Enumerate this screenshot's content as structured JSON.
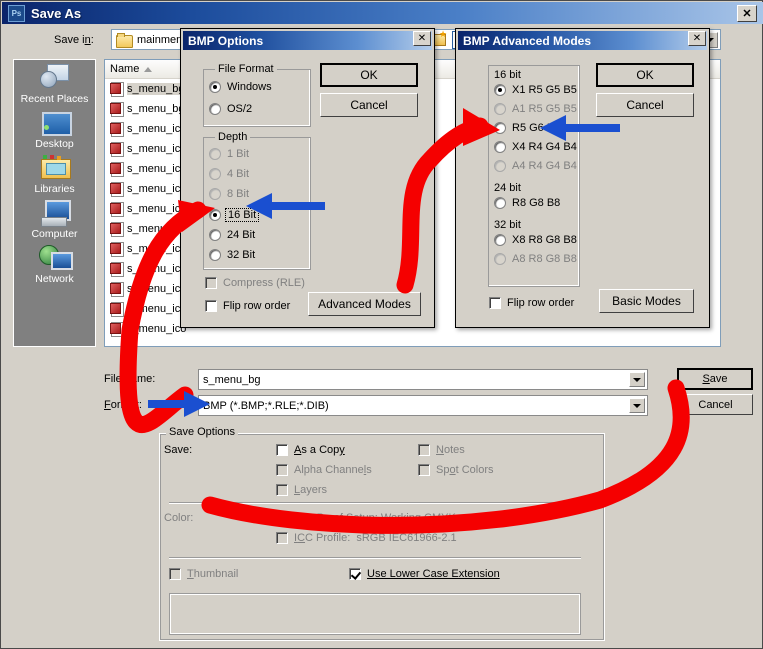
{
  "window": {
    "title": "Save As",
    "icon": "photoshop-icon",
    "icon_text": "Ps",
    "close_label": "✕"
  },
  "savein": {
    "label": "Save in:",
    "value": "mainmenu",
    "folder_icon": "folder-icon",
    "dropdown_icon": "chevron-down-icon",
    "toolbar": [
      {
        "name": "new-folder-icon"
      },
      {
        "name": "views-icon"
      }
    ]
  },
  "places": {
    "items": [
      {
        "label": "Recent Places",
        "icon": "recent-places-icon"
      },
      {
        "label": "Desktop",
        "icon": "desktop-icon"
      },
      {
        "label": "Libraries",
        "icon": "libraries-icon"
      },
      {
        "label": "Computer",
        "icon": "computer-icon"
      },
      {
        "label": "Network",
        "icon": "network-icon"
      }
    ]
  },
  "filelist": {
    "column_name": "Name",
    "sort_icon": "sort-ascending-icon",
    "rows": [
      {
        "name": "s_menu_bg",
        "selected": true
      },
      {
        "name": "s_menu_bg",
        "selected": false
      },
      {
        "name": "s_menu_ico",
        "selected": false
      },
      {
        "name": "s_menu_ico",
        "selected": false
      },
      {
        "name": "s_menu_ico",
        "selected": false
      },
      {
        "name": "s_menu_ico",
        "selected": false
      },
      {
        "name": "s_menu_ico",
        "selected": false
      },
      {
        "name": "s_menu_ico",
        "selected": false
      },
      {
        "name": "s_menu_ico",
        "selected": false
      },
      {
        "name": "s_menu_ico",
        "selected": false
      },
      {
        "name": "s_menu_ico",
        "selected": false
      },
      {
        "name": "s_menu_ico",
        "selected": false
      },
      {
        "name": "s_menu_ico",
        "selected": false
      }
    ]
  },
  "fields": {
    "filename_label": "File name:",
    "filename_value": "s_menu_bg",
    "format_label": "Format:",
    "format_value": "BMP (*.BMP;*.RLE;*.DIB)"
  },
  "buttons": {
    "save": "Save",
    "cancel": "Cancel"
  },
  "save_options": {
    "legend": "Save Options",
    "save_label": "Save:",
    "color_label": "Color:",
    "checkboxes": [
      {
        "label": "As a Copy",
        "checked": false,
        "disabled": false
      },
      {
        "label": "Alpha Channels",
        "checked": false,
        "disabled": true
      },
      {
        "label": "Layers",
        "checked": false,
        "disabled": true
      },
      {
        "label": "Notes",
        "checked": false,
        "disabled": true
      },
      {
        "label": "Spot Colors",
        "checked": false,
        "disabled": true
      },
      {
        "label": "Use Proof Setup:  Working CMYK",
        "checked": false,
        "disabled": true
      },
      {
        "label": "ICC Profile:  sRGB IEC61966-2.1",
        "checked": false,
        "disabled": true
      },
      {
        "label": "Thumbnail",
        "checked": false,
        "disabled": true
      },
      {
        "label": "Use Lower Case Extension",
        "checked": true,
        "disabled": false
      }
    ]
  },
  "bmp_options": {
    "title": "BMP Options",
    "close_label": "✕",
    "ok": "OK",
    "cancel": "Cancel",
    "advanced_modes": "Advanced Modes",
    "file_format": {
      "legend": "File Format",
      "options": [
        {
          "label": "Windows",
          "selected": true,
          "disabled": false
        },
        {
          "label": "OS/2",
          "selected": false,
          "disabled": false
        }
      ]
    },
    "depth": {
      "legend": "Depth",
      "options": [
        {
          "label": "1 Bit",
          "selected": false,
          "disabled": true
        },
        {
          "label": "4 Bit",
          "selected": false,
          "disabled": true
        },
        {
          "label": "8 Bit",
          "selected": false,
          "disabled": true
        },
        {
          "label": "16 Bit",
          "selected": true,
          "disabled": false,
          "focused": true
        },
        {
          "label": "24 Bit",
          "selected": false,
          "disabled": false
        },
        {
          "label": "32 Bit",
          "selected": false,
          "disabled": false
        }
      ]
    },
    "compress_rle": {
      "label": "Compress (RLE)",
      "checked": false,
      "disabled": true
    },
    "flip_row_order": {
      "label": "Flip row order",
      "checked": false,
      "disabled": false
    }
  },
  "bmp_advanced": {
    "title": "BMP Advanced Modes",
    "close_label": "✕",
    "ok": "OK",
    "cancel": "Cancel",
    "basic_modes": "Basic Modes",
    "groups": [
      {
        "heading": "16 bit",
        "options": [
          {
            "label": "X1 R5 G5 B5",
            "selected": true,
            "disabled": false
          },
          {
            "label": "A1 R5 G5 B5",
            "selected": false,
            "disabled": true
          },
          {
            "label": "R5 G6 B5",
            "selected": false,
            "disabled": false
          },
          {
            "label": "X4 R4 G4 B4",
            "selected": false,
            "disabled": false
          },
          {
            "label": "A4 R4 G4 B4",
            "selected": false,
            "disabled": true
          }
        ]
      },
      {
        "heading": "24 bit",
        "options": [
          {
            "label": "R8 G8 B8",
            "selected": false,
            "disabled": false
          }
        ]
      },
      {
        "heading": "32 bit",
        "options": [
          {
            "label": "X8 R8 G8 B8",
            "selected": false,
            "disabled": false
          },
          {
            "label": "A8 R8 G8 B8",
            "selected": false,
            "disabled": true
          }
        ]
      }
    ],
    "flip_row_order": {
      "label": "Flip row order",
      "checked": false,
      "disabled": false
    }
  },
  "annotations": {
    "arrow_color_blue": "#1a4fd0",
    "arrow_color_red": "#f50000",
    "blue_arrows": [
      {
        "name": "arrow-to-16bit-radio",
        "target": "16 Bit"
      },
      {
        "name": "arrow-to-r5g6b5-radio",
        "target": "R5 G6 B5"
      },
      {
        "name": "arrow-to-format-combo",
        "target": "Format:"
      }
    ],
    "red_strokes": [
      {
        "name": "red-stroke-format-to-16bit"
      },
      {
        "name": "red-stroke-advanced-to-adv-dialog"
      },
      {
        "name": "red-stroke-save-to-format"
      }
    ]
  }
}
